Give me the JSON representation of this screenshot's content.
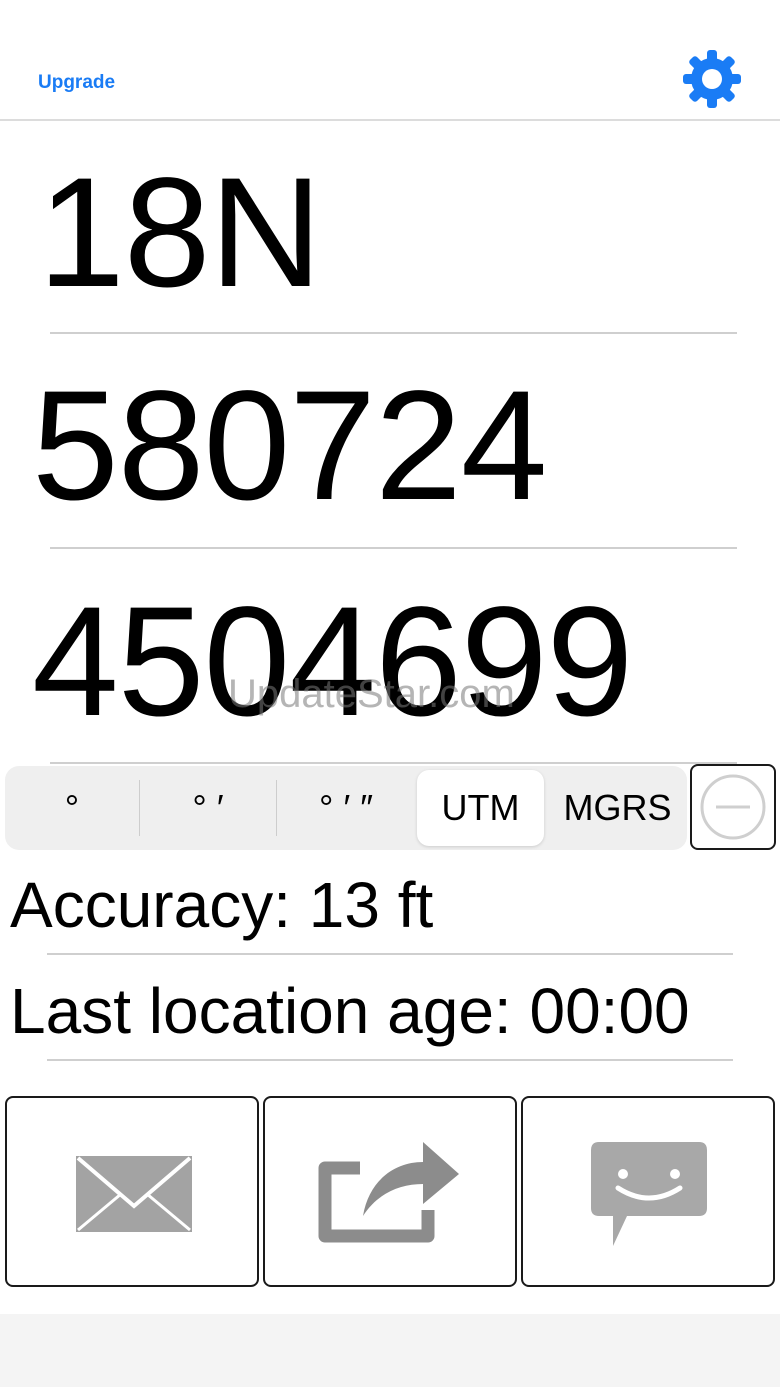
{
  "nav": {
    "upgrade_label": "Upgrade",
    "settings_icon": "gear-icon",
    "accent_color": "#1a7cf5"
  },
  "coordinates": {
    "zone": "18N",
    "easting": "580724",
    "northing": "4504699"
  },
  "watermark": "UpdateStar.com",
  "format_selector": {
    "options": [
      "°",
      "° ′",
      "° ′ ″",
      "UTM",
      "MGRS"
    ],
    "selected": "UTM"
  },
  "minus_icon": "minus-circle-icon",
  "status": {
    "accuracy": "Accuracy: 13 ft",
    "last_location_age": "Last location age: 00:00"
  },
  "actions": [
    {
      "icon": "email-icon"
    },
    {
      "icon": "share-icon"
    },
    {
      "icon": "message-icon"
    }
  ]
}
